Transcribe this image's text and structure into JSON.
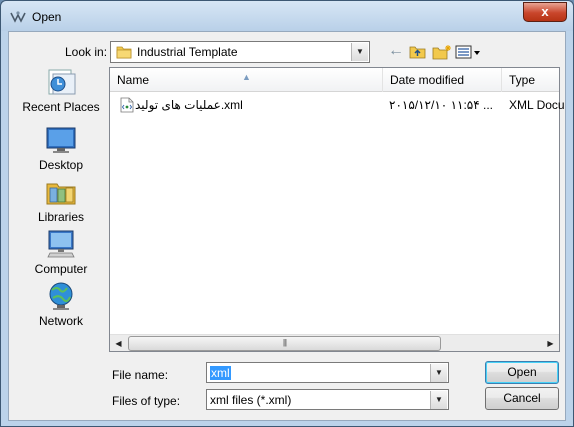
{
  "window": {
    "title": "Open",
    "close_label": "x"
  },
  "toolbar": {
    "lookin_label": "Look in:",
    "lookin_value": "Industrial Template",
    "back_glyph": "←"
  },
  "places": [
    {
      "label": "Recent Places",
      "icon": "recent-places-icon"
    },
    {
      "label": "Desktop",
      "icon": "desktop-icon"
    },
    {
      "label": "Libraries",
      "icon": "libraries-icon"
    },
    {
      "label": "Computer",
      "icon": "computer-icon"
    },
    {
      "label": "Network",
      "icon": "network-icon"
    }
  ],
  "filelist": {
    "columns": [
      "Name",
      "Date modified",
      "Type"
    ],
    "rows": [
      {
        "name": "عملیات های تولید.xml",
        "date": "۲۰۱۵/۱۲/۱۰ ۱۱:۵۴ ...",
        "type": "XML Docu"
      }
    ],
    "scroll_grip": "|||"
  },
  "footer": {
    "filename_label": "File name:",
    "filename_value": "xml",
    "filetype_label": "Files of type:",
    "filetype_value": "xml files (*.xml)",
    "open_label": "Open",
    "cancel_label": "Cancel"
  },
  "colors": {
    "title_bar": "#c7dcf1",
    "close_button": "#c9462c",
    "selection": "#3399ff"
  }
}
